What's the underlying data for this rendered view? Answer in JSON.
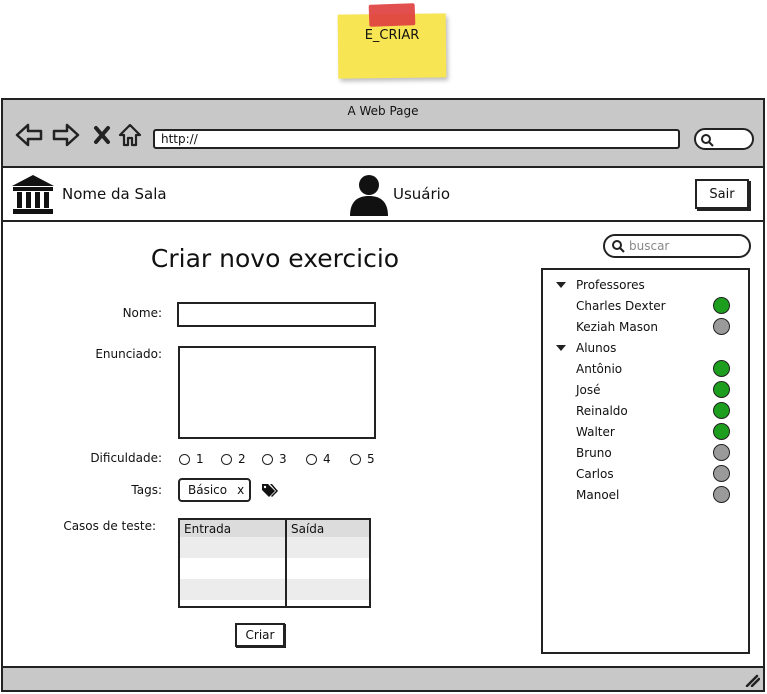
{
  "sticky_note": {
    "label": "E_CRIAR"
  },
  "browser": {
    "title": "A Web Page",
    "url": "http://"
  },
  "header": {
    "room_name": "Nome da Sala",
    "user_label": "Usuário",
    "logout_label": "Sair"
  },
  "form": {
    "title": "Criar novo exercicio",
    "name_label": "Nome:",
    "name_value": "",
    "statement_label": "Enunciado:",
    "statement_value": "",
    "difficulty_label": "Dificuldade:",
    "difficulty_options": [
      "1",
      "2",
      "3",
      "4",
      "5"
    ],
    "tags_label": "Tags:",
    "tag": "Básico",
    "tag_remove": "x",
    "tests_label": "Casos de teste:",
    "tests_columns": [
      "Entrada",
      "Saída"
    ],
    "submit_label": "Criar"
  },
  "sidebar": {
    "search_placeholder": "buscar",
    "groups": [
      {
        "name": "Professores",
        "members": [
          {
            "name": "Charles Dexter",
            "status": "online"
          },
          {
            "name": "Keziah Mason",
            "status": "offline"
          }
        ]
      },
      {
        "name": "Alunos",
        "members": [
          {
            "name": "Antônio",
            "status": "online"
          },
          {
            "name": "José",
            "status": "online"
          },
          {
            "name": "Reinaldo",
            "status": "online"
          },
          {
            "name": "Walter",
            "status": "online"
          },
          {
            "name": "Bruno",
            "status": "offline"
          },
          {
            "name": "Carlos",
            "status": "offline"
          },
          {
            "name": "Manoel",
            "status": "offline"
          }
        ]
      }
    ]
  },
  "colors": {
    "online": "#1e9e1e",
    "offline": "#9a9a9a",
    "chrome": "#c8c8c8",
    "sticky": "#f7e553"
  }
}
